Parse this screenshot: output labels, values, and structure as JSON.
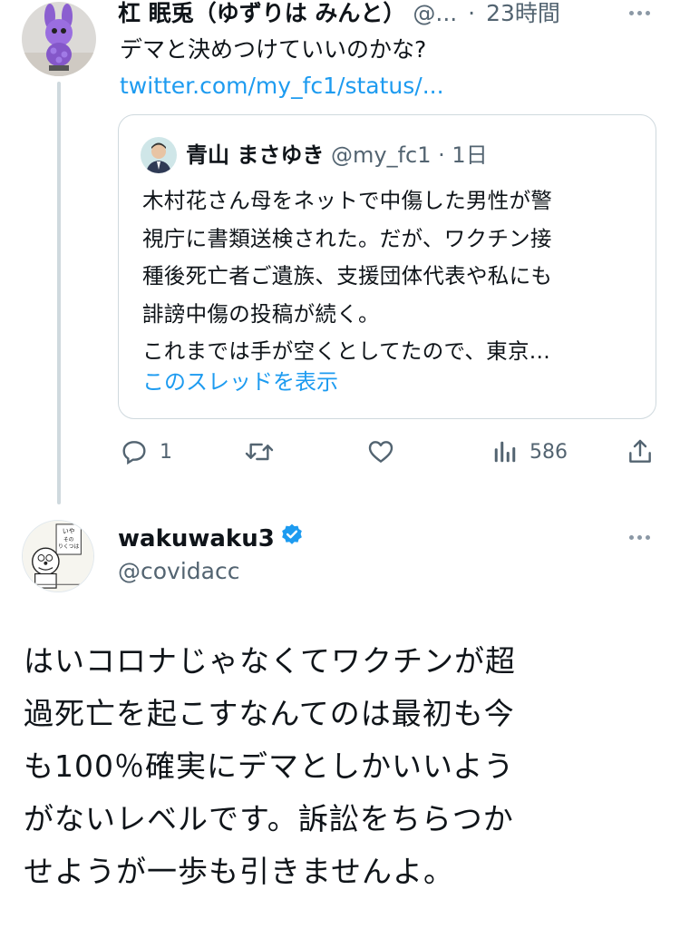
{
  "tweet1": {
    "author_name": "杠 眠兎（ゆずりは みんと）",
    "handle": "@...",
    "dot": "·",
    "time": "23時間",
    "text": "デマと決めつけていいのかな?",
    "link": "twitter.com/my_fc1/status/..."
  },
  "quoted": {
    "author_name": "青山 まさゆき",
    "handle": "@my_fc1",
    "dot": "·",
    "time": "1日",
    "lines": [
      "木村花さん母をネットで中傷した男性が警",
      "視庁に書類送検された。だが、ワクチン接",
      "種後死亡者ご遺族、支援団体代表や私にも",
      "誹謗中傷の投稿が続く。",
      "これまでは手が空くとしてたので、東京..."
    ],
    "thread_link": "このスレッドを表示"
  },
  "actions": {
    "reply_count": "1",
    "retweet_count": "",
    "like_count": "",
    "view_count": "586"
  },
  "tweet2": {
    "author_name": "wakuwaku3",
    "handle": "@covidacc",
    "lines": [
      "はいコロナじゃなくてワクチンが超",
      "過死亡を起こすなんてのは最初も今",
      "も100％確実にデマとしかいいよう",
      "がないレベルです。訴訟をちらつか",
      "せようが一歩も引きませんよ。"
    ]
  },
  "colors": {
    "link": "#1d9bf0",
    "secondary": "#536471",
    "verified": "#1d9bf0",
    "border": "#cfd9de"
  }
}
